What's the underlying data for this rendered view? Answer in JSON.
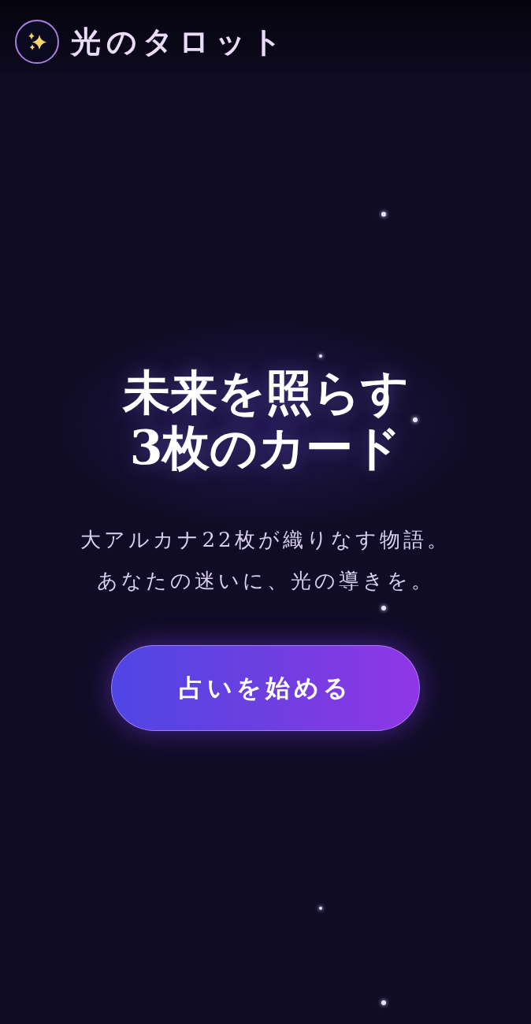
{
  "header": {
    "title": "光のタロット"
  },
  "hero": {
    "heading_lines": [
      "未来を照らす",
      "3枚のカード"
    ],
    "description_lines": [
      "大アルカナ22枚が織りなす物語。",
      "あなたの迷いに、光の導きを。"
    ],
    "button": {
      "label": "占いを始める"
    }
  }
}
